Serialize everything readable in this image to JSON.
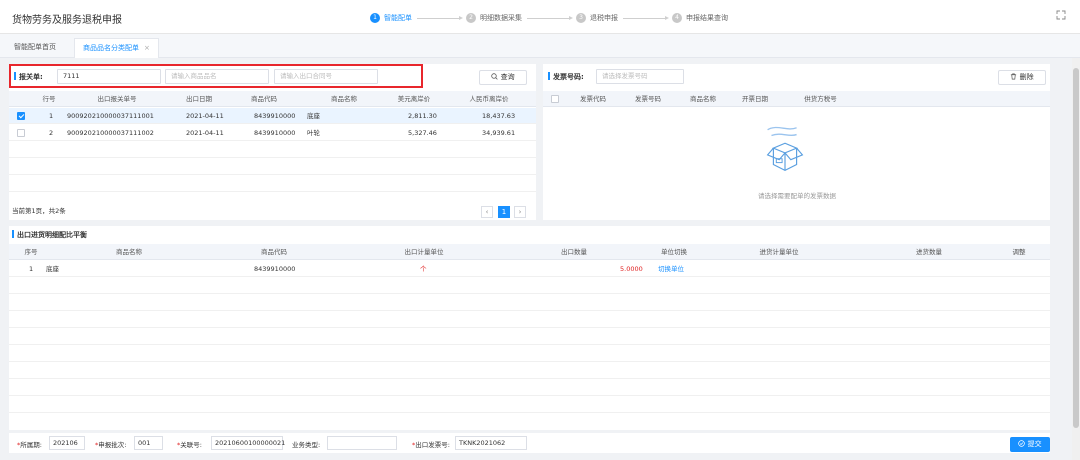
{
  "app": {
    "title": "货物劳务及服务退税申报",
    "steps": [
      {
        "num": "1",
        "label": "智能配单"
      },
      {
        "num": "2",
        "label": "明细数据采集"
      },
      {
        "num": "3",
        "label": "退税申报"
      },
      {
        "num": "4",
        "label": "申报结果查询"
      }
    ]
  },
  "tabs": [
    {
      "label": "智能配单首页"
    },
    {
      "label": "商品品名分类配单",
      "close": "×"
    }
  ],
  "search": {
    "label": "报关单:",
    "value": "7111",
    "product_placeholder": "请输入商品品名",
    "contract_placeholder": "请输入出口合同号",
    "query_label": "查询"
  },
  "invoice_search": {
    "label": "发票号码:",
    "placeholder": "请选择发票号码",
    "delete_label": "删除"
  },
  "decl_table": {
    "headers": [
      "行号",
      "出口报关单号",
      "出口日期",
      "商品代码",
      "商品名称",
      "美元离岸价",
      "人民币离岸价"
    ],
    "rows": [
      {
        "no": "1",
        "decl": "900920210000037111001",
        "date": "2021-04-11",
        "code": "8439910000",
        "name": "底座",
        "usd": "2,811.30",
        "rmb": "18,437.63",
        "checked": true
      },
      {
        "no": "2",
        "decl": "900920210000037111002",
        "date": "2021-04-11",
        "code": "8439910000",
        "name": "叶轮",
        "usd": "5,327.46",
        "rmb": "34,939.61",
        "checked": false
      }
    ],
    "page_info": "当前第1页，共2条",
    "page_current": "1"
  },
  "invoice_table": {
    "headers": [
      "发票代码",
      "发票号码",
      "商品名称",
      "开票日期",
      "供货方税号"
    ],
    "empty_text": "请选择需要配单的发票数据"
  },
  "detail": {
    "title": "出口进货明细配比平衡",
    "headers": [
      "序号",
      "商品名称",
      "商品代码",
      "出口计量单位",
      "出口数量",
      "单位切换",
      "进货计量单位",
      "进货数量",
      "调整"
    ],
    "rows": [
      {
        "no": "1",
        "name": "底座",
        "code": "8439910000",
        "unit": "个",
        "qty": "5.0000",
        "switch": "切换单位",
        "in_unit": "",
        "in_qty": "",
        "adjust": ""
      }
    ]
  },
  "footer": {
    "period_label": "所属期:",
    "period_value": "202106",
    "batch_label": "申报批次:",
    "batch_value": "001",
    "link_label": "关联号:",
    "link_value": "20210600100000021",
    "biz_label": "业务类型:",
    "biz_value": "",
    "invoice_label": "出口发票号:",
    "invoice_value": "TKNK2021062",
    "submit_label": "提交"
  },
  "colors": {
    "primary": "#1890ff",
    "highlight": "#e8262c",
    "required": "#e02020"
  }
}
